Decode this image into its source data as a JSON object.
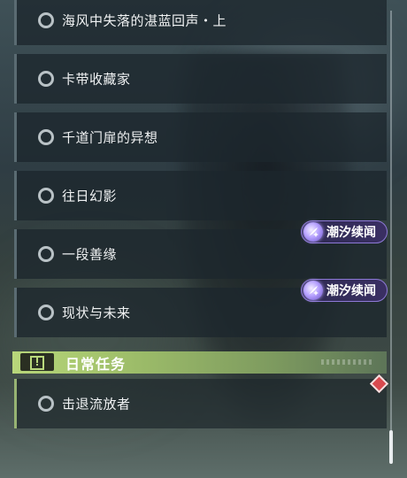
{
  "quests": [
    {
      "label": "海风中失落的湛蓝回声・上",
      "tag": null
    },
    {
      "label": "卡带收藏家",
      "tag": null
    },
    {
      "label": "千道门扉的异想",
      "tag": null
    },
    {
      "label": "往日幻影",
      "tag": null
    },
    {
      "label": "一段善缘",
      "tag": "潮汐续闻"
    },
    {
      "label": "现状与未来",
      "tag": "潮汐续闻"
    }
  ],
  "daily_section": {
    "title": "日常任务",
    "icon": "exclamation-icon",
    "items": [
      {
        "label": "击退流放者"
      }
    ]
  },
  "tag_icon": "feather-sparkle-icon",
  "colors": {
    "daily_accent": "#b8d77a",
    "tag_border": "#8d79d6",
    "tracking_marker": "#d84a4f"
  }
}
